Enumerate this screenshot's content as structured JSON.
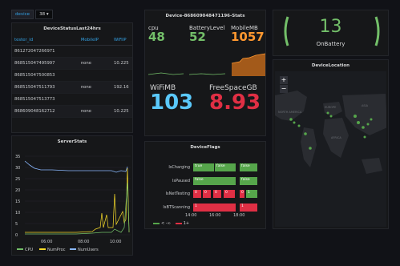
{
  "variable": {
    "label": "device",
    "value": "38 ▾"
  },
  "table": {
    "title": "DeviceStatusLast24hrs",
    "columns": [
      "tester_id",
      "MobileIP",
      "WiFiIP"
    ],
    "rows": [
      [
        "861272047266971",
        "",
        ""
      ],
      [
        "868515047495997",
        "none",
        "10.225"
      ],
      [
        "868515047500853",
        "",
        ""
      ],
      [
        "868515047511793",
        "none",
        "192.16"
      ],
      [
        "868515047513773",
        "",
        ""
      ],
      [
        "868609048162712",
        "none",
        "10.225"
      ]
    ]
  },
  "stats": {
    "title": "Device-868609048471196-Stats",
    "cpu": {
      "label": "cpu",
      "value": "48"
    },
    "battery": {
      "label": "BatteryLevel",
      "value": "52"
    },
    "mobile": {
      "label": "MobileMB",
      "value": "1057"
    },
    "wifi": {
      "label": "WiFiMB",
      "value": "103"
    },
    "free": {
      "label": "FreeSpaceGB",
      "value": "8.93"
    }
  },
  "on_battery": {
    "value": "13",
    "label": "OnBattery"
  },
  "map": {
    "title": "DeviceLocation",
    "zoom_in": "+",
    "zoom_out": "−",
    "labels": [
      "EUROPE",
      "AFRICA",
      "ASIA",
      "NORTH AMERICA"
    ]
  },
  "server": {
    "title": "ServerStats",
    "yticks": [
      "35",
      "30",
      "25",
      "20",
      "15",
      "10",
      "5",
      "0"
    ],
    "xticks": [
      "06:00",
      "08:00",
      "10:00"
    ],
    "legend": [
      "CPU",
      "NumProc",
      "NumUsers"
    ]
  },
  "flags": {
    "title": "DeviceFlags",
    "rows": [
      {
        "label": "IsCharging",
        "cells": [
          "true",
          "false",
          "false"
        ]
      },
      {
        "label": "IsPaused",
        "cells": [
          "false",
          "false"
        ]
      },
      {
        "label": "IsNetTesting",
        "cells": [
          "0",
          "0",
          "0",
          "0",
          "0",
          "1"
        ]
      },
      {
        "label": "IsBTScanning",
        "cells": [
          "1",
          "1"
        ]
      }
    ],
    "xticks": [
      "14:00",
      "16:00",
      "18:00"
    ],
    "legend": [
      "< -∞",
      "1+"
    ]
  },
  "colors": {
    "green": "#73bf69",
    "orange": "#ff9830",
    "cyan": "#5ac8fa",
    "red": "#e02f44",
    "blue": "#8ab8ff",
    "yellow": "#fade2a"
  }
}
